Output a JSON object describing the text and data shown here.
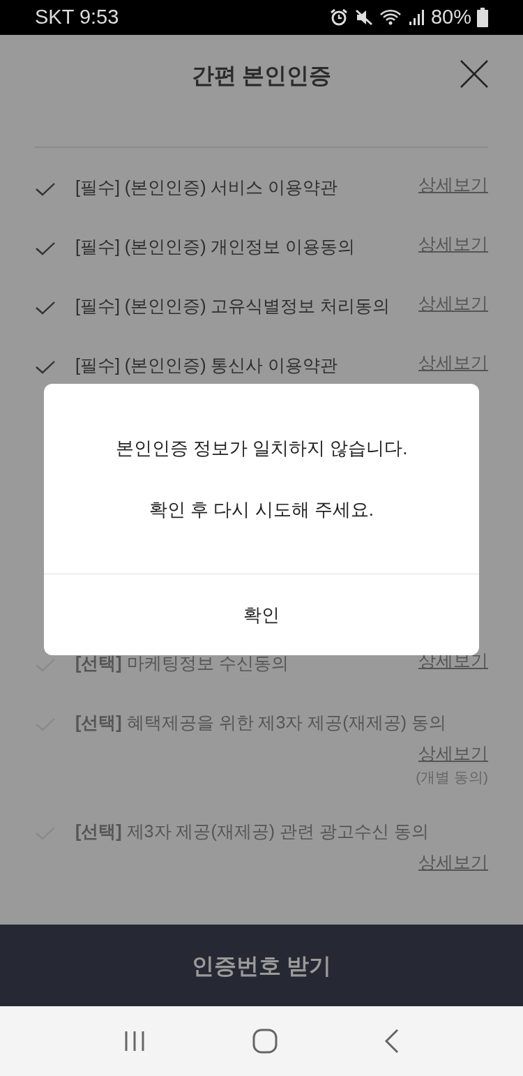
{
  "status_bar": {
    "carrier_time": "SKT 9:53",
    "battery": "80%"
  },
  "header": {
    "title": "간편 본인인증"
  },
  "agreements": [
    {
      "kind": "required",
      "text": "[필수] (본인인증) 서비스 이용약관",
      "checked": true,
      "link": "상세보기"
    },
    {
      "kind": "required",
      "text": "[필수] (본인인증) 개인정보 이용동의",
      "checked": true,
      "link": "상세보기"
    },
    {
      "kind": "required",
      "text": "[필수] (본인인증) 고유식별정보 처리동의",
      "checked": true,
      "link": "상세보기"
    },
    {
      "kind": "required",
      "text": "[필수] (본인인증) 통신사 이용약관",
      "checked": true,
      "link": "상세보기"
    },
    {
      "kind": "optional",
      "text": "**[선택]** 마케팅정보 수신동의",
      "checked": false,
      "link": "상세보기"
    },
    {
      "kind": "optional",
      "text": "**[선택]** 혜택제공을 위한 제3자 제공(재제공) 동의",
      "checked": false,
      "link": "상세보기",
      "note": "(개별 동의)"
    },
    {
      "kind": "optional",
      "text": "**[선택]** 제3자 제공(재제공) 관련 광고수신 동의",
      "checked": false,
      "link": "상세보기"
    }
  ],
  "submit_button": "인증번호 받기",
  "dialog": {
    "lines": [
      "본인인증 정보가 일치하지 않습니다.",
      "확인 후 다시 시도해 주세요."
    ],
    "button": "확인"
  }
}
